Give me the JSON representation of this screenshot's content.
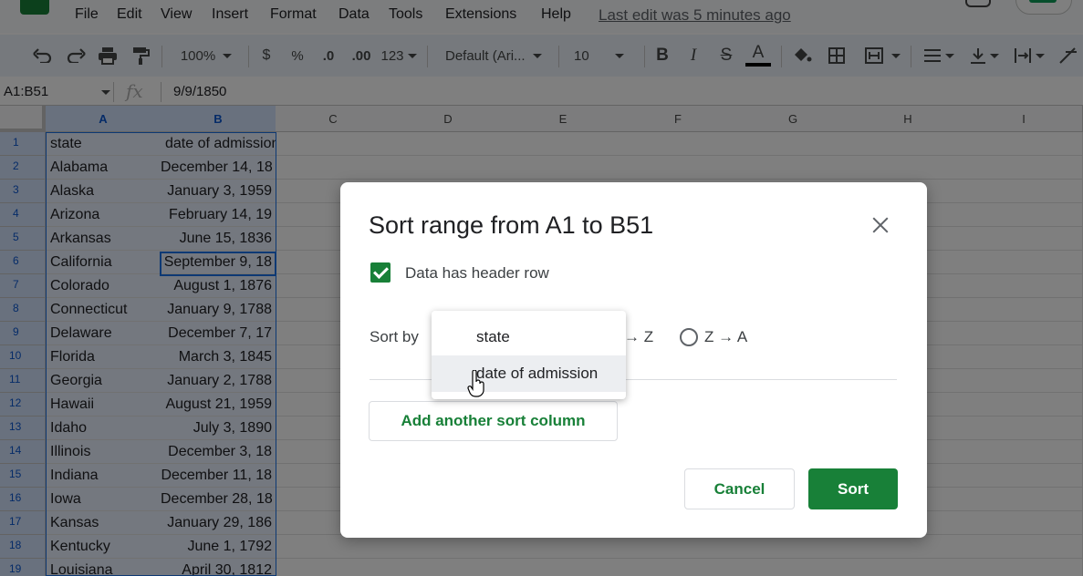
{
  "menu": {
    "items": [
      "File",
      "Edit",
      "View",
      "Insert",
      "Format",
      "Data",
      "Tools",
      "Extensions",
      "Help"
    ],
    "last_edit": "Last edit was 5 minutes ago"
  },
  "toolbar": {
    "zoom": "100%",
    "currency": "$",
    "percent": "%",
    "decrease_decimal": ".0",
    "increase_decimal": ".00",
    "more_formats": "123",
    "font": "Default (Ari...",
    "font_size": "10",
    "bold": "B",
    "italic": "I",
    "strike": "S",
    "text_color": "A",
    "text_color_value": "#000000"
  },
  "formula_bar": {
    "name_box": "A1:B51",
    "fx": "fx",
    "formula": "9/9/1850"
  },
  "grid": {
    "columns": [
      "A",
      "B",
      "C",
      "D",
      "E",
      "F",
      "G",
      "H",
      "I"
    ],
    "rows": [
      {
        "n": "1",
        "state": "state",
        "date": "date of admission"
      },
      {
        "n": "2",
        "state": "Alabama",
        "date": "December 14, 18"
      },
      {
        "n": "3",
        "state": "Alaska",
        "date": "January 3, 1959"
      },
      {
        "n": "4",
        "state": "Arizona",
        "date": "February 14, 19"
      },
      {
        "n": "5",
        "state": "Arkansas",
        "date": "June 15, 1836"
      },
      {
        "n": "6",
        "state": "California",
        "date": "September 9, 18"
      },
      {
        "n": "7",
        "state": "Colorado",
        "date": "August 1, 1876"
      },
      {
        "n": "8",
        "state": "Connecticut",
        "date": "January 9, 1788"
      },
      {
        "n": "9",
        "state": "Delaware",
        "date": "December 7, 17"
      },
      {
        "n": "10",
        "state": "Florida",
        "date": "March 3, 1845"
      },
      {
        "n": "11",
        "state": "Georgia",
        "date": "January 2, 1788"
      },
      {
        "n": "12",
        "state": "Hawaii",
        "date": "August 21, 1959"
      },
      {
        "n": "13",
        "state": "Idaho",
        "date": "July 3, 1890"
      },
      {
        "n": "14",
        "state": "Illinois",
        "date": "December 3, 18"
      },
      {
        "n": "15",
        "state": "Indiana",
        "date": "December 11, 18"
      },
      {
        "n": "16",
        "state": "Iowa",
        "date": "December 28, 18"
      },
      {
        "n": "17",
        "state": "Kansas",
        "date": "January 29, 186"
      },
      {
        "n": "18",
        "state": "Kentucky",
        "date": "June 1, 1792"
      },
      {
        "n": "19",
        "state": "Louisiana",
        "date": "April 30, 1812"
      }
    ]
  },
  "dialog": {
    "title": "Sort range from A1 to B51",
    "header_checkbox_label": "Data has header row",
    "header_checked": true,
    "sort_by_label": "Sort by",
    "az_label": "→ Z",
    "za_label": "Z → A",
    "add_column": "Add another sort column",
    "cancel": "Cancel",
    "sort": "Sort",
    "accent": "#188038",
    "dropdown_options": [
      "state",
      "date of admission"
    ],
    "highlighted_option": "date of admission"
  }
}
